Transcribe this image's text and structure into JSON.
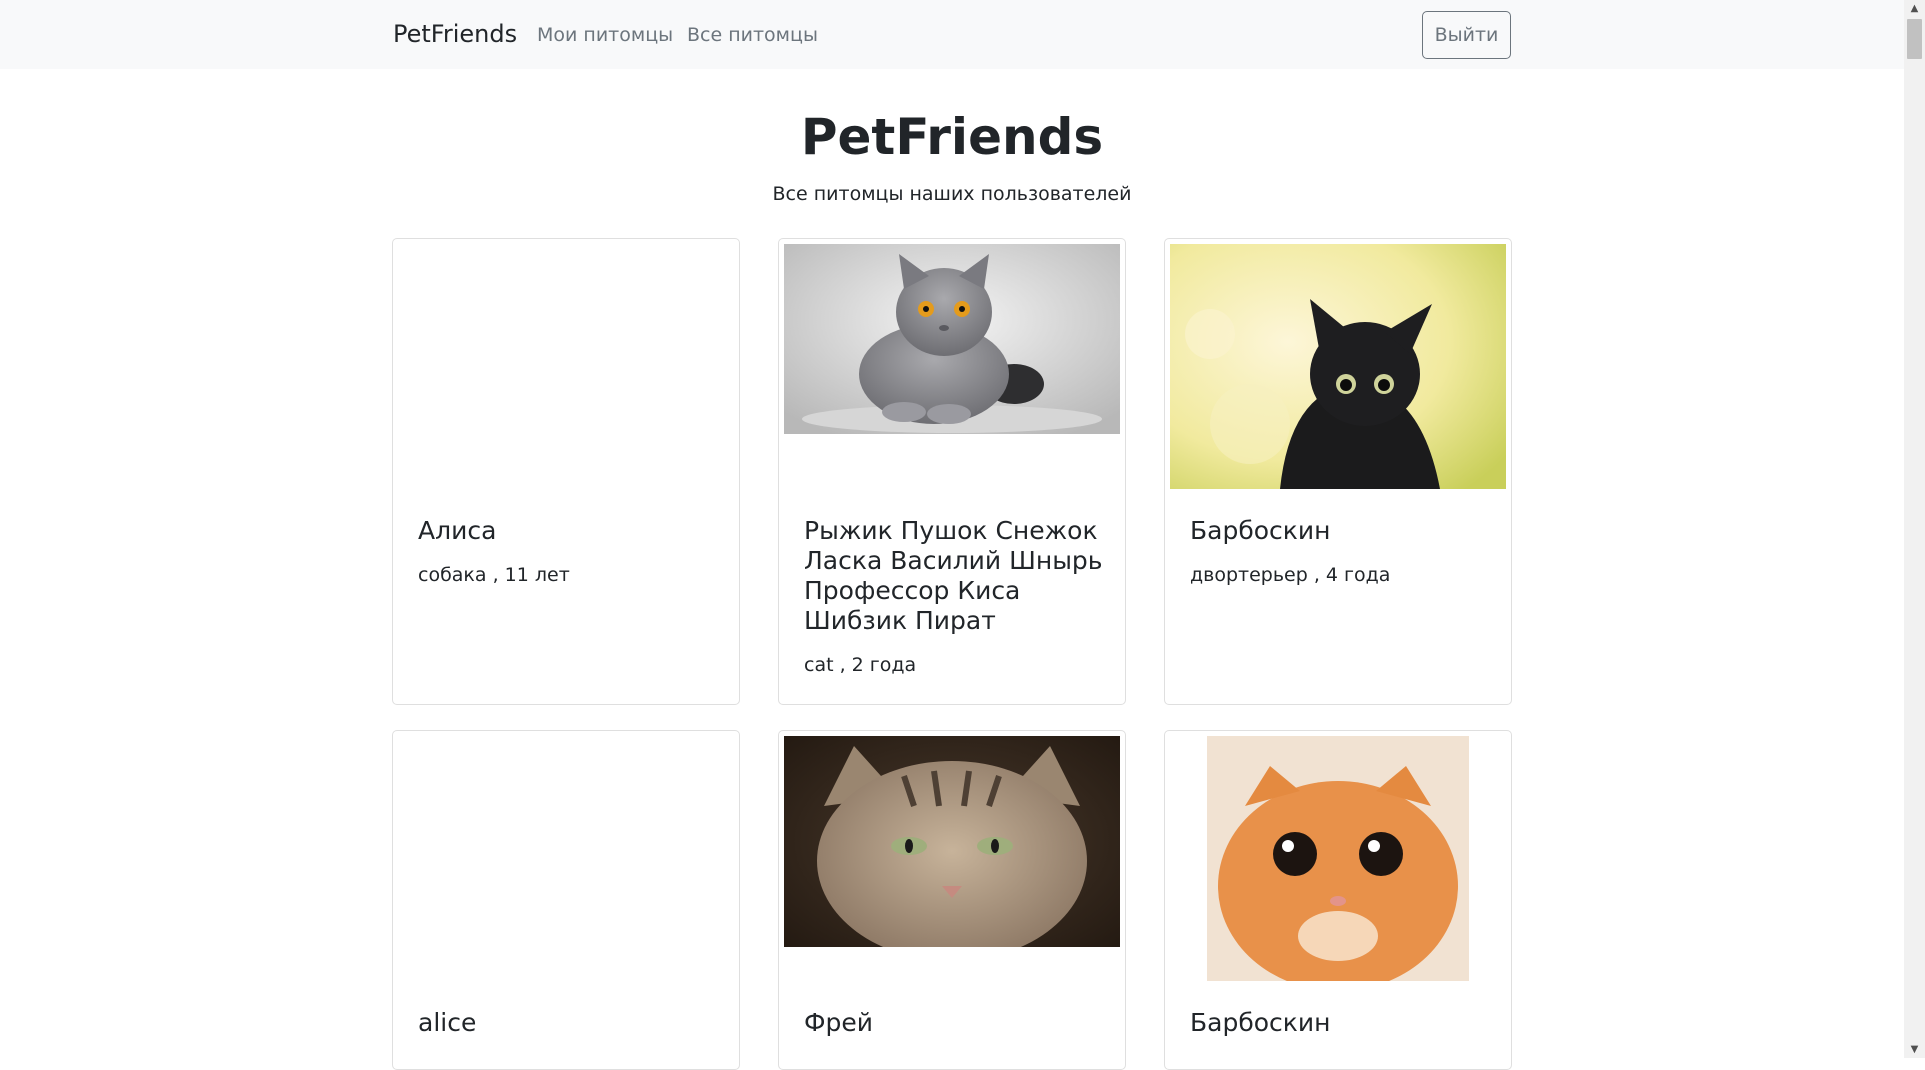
{
  "navbar": {
    "brand": "PetFriends",
    "links": [
      {
        "label": "Мои питомцы"
      },
      {
        "label": "Все питомцы"
      }
    ],
    "logout_label": "Выйти"
  },
  "header": {
    "title": "PetFriends",
    "subtitle": "Все питомцы наших пользователей"
  },
  "pets": [
    {
      "name": "Алиса",
      "details": "собака , 11 лет",
      "photo": "none"
    },
    {
      "name": "Рыжик Пушок Снежок Ласка Василий Шнырь Профессор Киса Шибзик Пират",
      "details": "cat , 2 года",
      "photo": "grey-cat"
    },
    {
      "name": "Барбоскин",
      "details": "двортерьер , 4 года",
      "photo": "black-kitten"
    },
    {
      "name": "alice",
      "details": "",
      "photo": "none"
    },
    {
      "name": "Фрей",
      "details": "",
      "photo": "tabby-cat"
    },
    {
      "name": "Барбоскин",
      "details": "",
      "photo": "ginger-cat"
    }
  ],
  "colors": {
    "navbar_bg": "#f8f9fa",
    "muted": "#6c757d",
    "text": "#212529"
  }
}
